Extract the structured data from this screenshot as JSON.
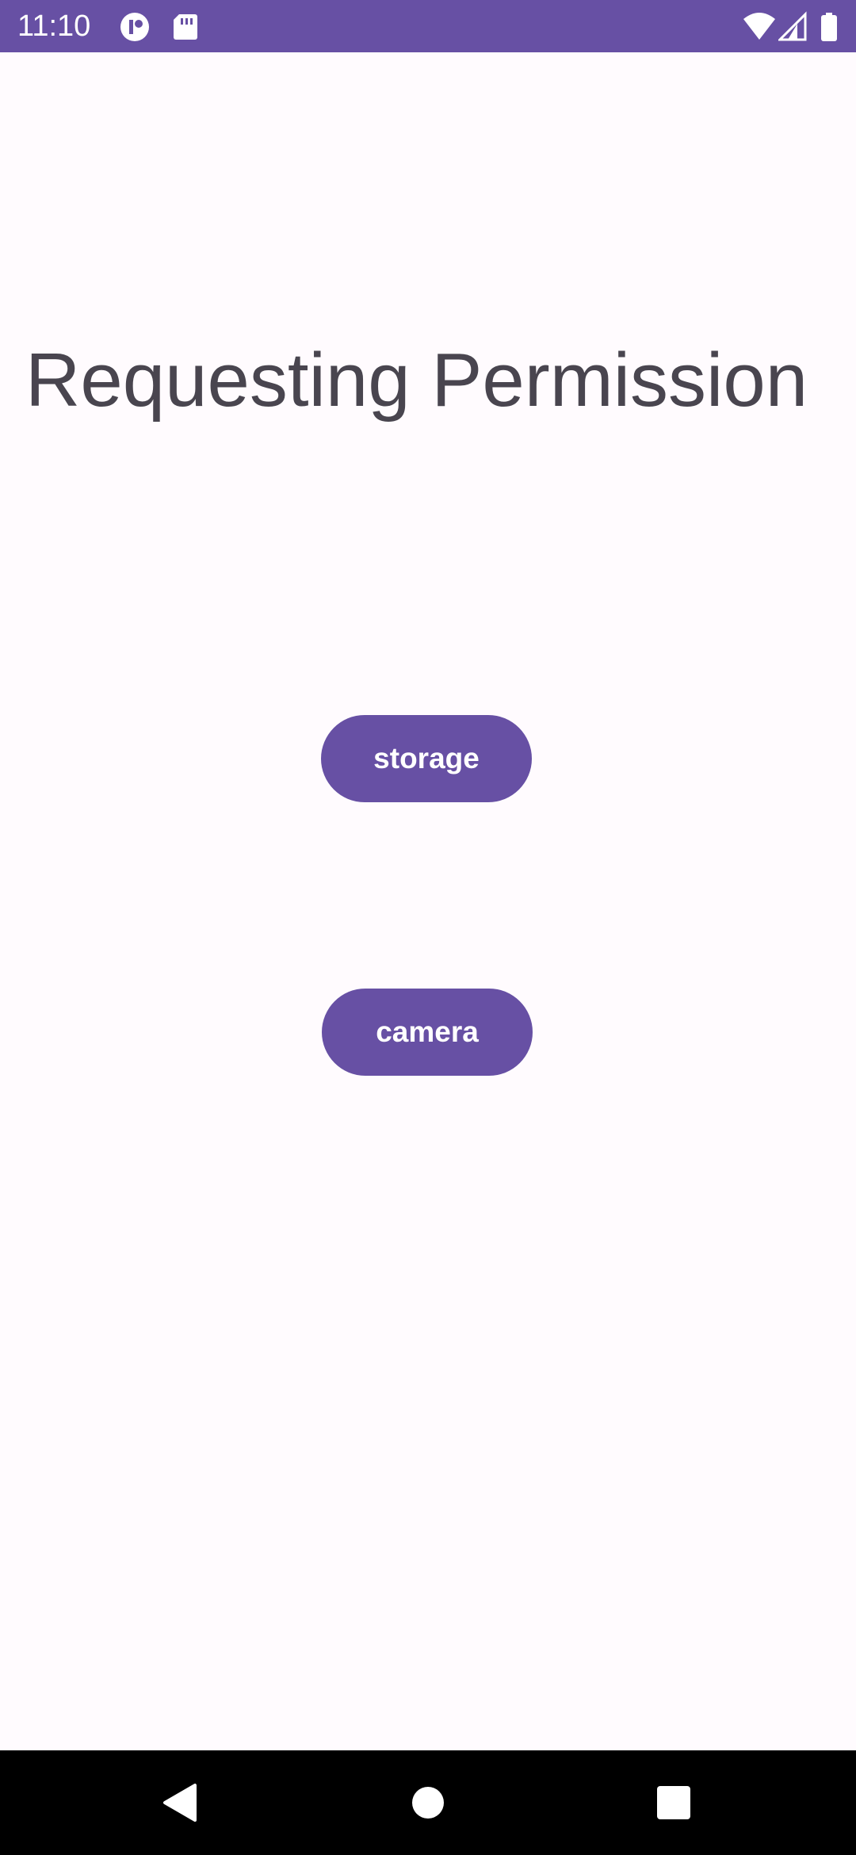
{
  "status_bar": {
    "time": "11:10",
    "background_color": "#6750A4",
    "left_icons": [
      "app-notification-icon",
      "sd-card-icon"
    ],
    "right_icons": [
      "wifi-icon",
      "cell-signal-icon",
      "battery-icon"
    ]
  },
  "main": {
    "title": "Requesting Permission",
    "buttons": {
      "storage_label": "storage",
      "camera_label": "camera"
    },
    "button_color": "#6750A4",
    "background_color": "#FFFBFE"
  },
  "nav_bar": {
    "icons": [
      "back-icon",
      "home-icon",
      "recents-icon"
    ]
  }
}
